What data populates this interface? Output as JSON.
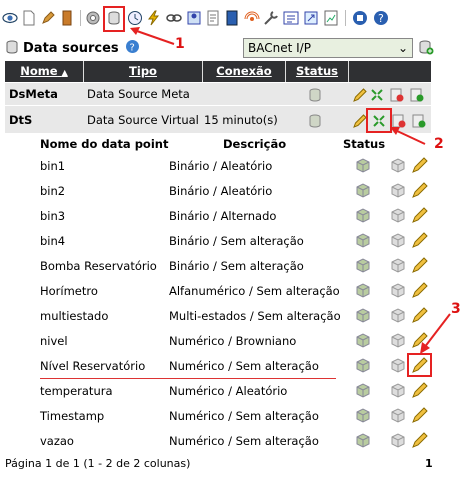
{
  "header": {
    "title": "Data sources",
    "select_value": "BACnet I/P"
  },
  "table": {
    "columns": [
      "Nome",
      "Tipo",
      "Conexão",
      "Status"
    ],
    "rows": [
      {
        "name": "DsMeta",
        "type": "Data Source Meta",
        "connection": ""
      },
      {
        "name": "DtS",
        "type": "Data Source Virtual",
        "connection": "15 minuto(s)"
      }
    ]
  },
  "points_header": {
    "name": "Nome do data point",
    "description": "Descrição",
    "status": "Status"
  },
  "points": [
    {
      "name": "bin1",
      "description": "Binário / Aleatório"
    },
    {
      "name": "bin2",
      "description": "Binário / Aleatório"
    },
    {
      "name": "bin3",
      "description": "Binário / Alternado"
    },
    {
      "name": "bin4",
      "description": "Binário / Sem alteração"
    },
    {
      "name": "Bomba Reservatório",
      "description": "Binário / Sem alteração"
    },
    {
      "name": "Horímetro",
      "description": "Alfanumérico / Sem alteração"
    },
    {
      "name": "multiestado",
      "description": "Multi-estados / Sem alteração"
    },
    {
      "name": "nivel",
      "description": "Numérico / Browniano"
    },
    {
      "name": "Nível Reservatório",
      "description": "Numérico / Sem alteração"
    },
    {
      "name": "temperatura",
      "description": "Numérico / Aleatório"
    },
    {
      "name": "Timestamp",
      "description": "Numérico / Sem alteração"
    },
    {
      "name": "vazao",
      "description": "Numérico / Sem alteração"
    }
  ],
  "footer": {
    "pagination": "Página 1 de 1 (1 - 2 de 2 colunas)",
    "page_number": "1"
  },
  "annotations": [
    "1",
    "2",
    "3"
  ],
  "toolbar_icons": [
    "eye-icon",
    "document-icon",
    "pen-icon",
    "book-icon",
    "gear-icon",
    "datasource-icon",
    "clock-icon",
    "bolt-icon",
    "link-icon",
    "user-icon",
    "docs-icon",
    "notebook-icon",
    "antenna-icon",
    "wrench-icon",
    "list-icon",
    "export-icon",
    "chart-icon",
    "stop-icon",
    "help-icon"
  ],
  "colors": {
    "annotation": "#e52222",
    "header_bg": "#2f3033",
    "row_bg": "#e8e8e8"
  }
}
